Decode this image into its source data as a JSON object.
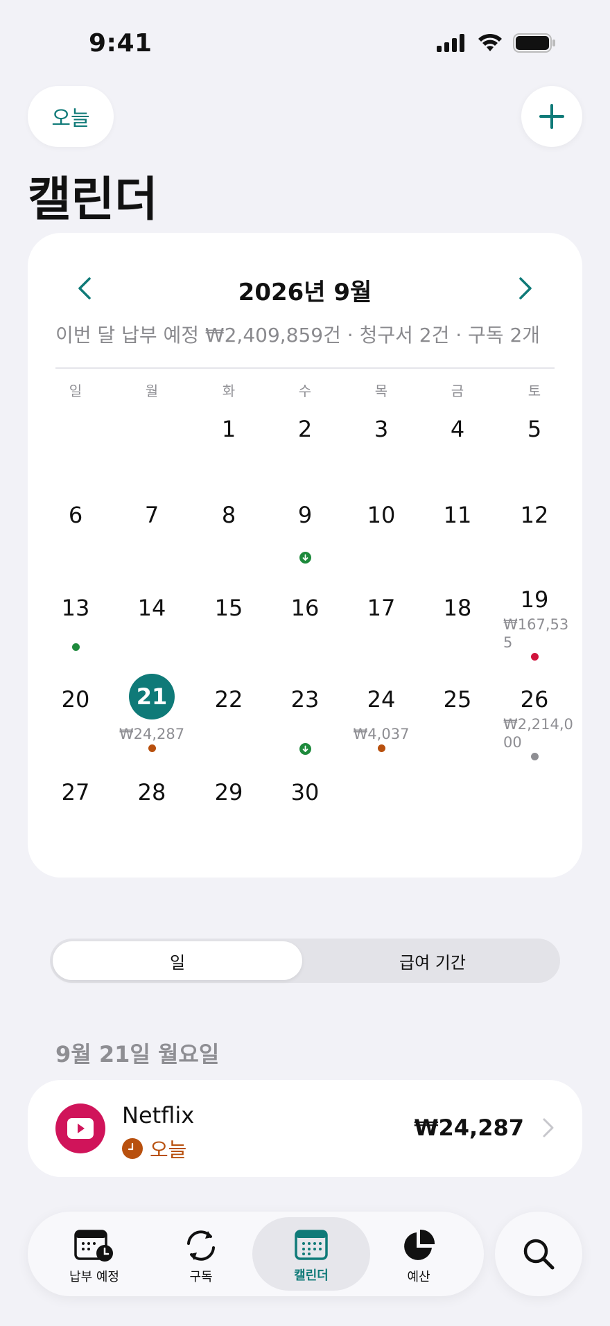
{
  "status_bar": {
    "time": "9:41"
  },
  "header": {
    "today_label": "오늘",
    "title": "캘린더"
  },
  "calendar": {
    "month_title": "2026년 9월",
    "summary": "이번 달 납부 예정 ₩2,409,859건 · 청구서 2건 · 구독 2개",
    "weekdays": [
      "일",
      "월",
      "화",
      "수",
      "목",
      "금",
      "토"
    ],
    "days": {
      "d1": "1",
      "d2": "2",
      "d3": "3",
      "d4": "4",
      "d5": "5",
      "d6": "6",
      "d7": "7",
      "d8": "8",
      "d9": "9",
      "d10": "10",
      "d11": "11",
      "d12": "12",
      "d13": "13",
      "d14": "14",
      "d15": "15",
      "d16": "16",
      "d17": "17",
      "d18": "18",
      "d19": "19",
      "d20": "20",
      "d21": "21",
      "d22": "22",
      "d23": "23",
      "d24": "24",
      "d25": "25",
      "d26": "26",
      "d27": "27",
      "d28": "28",
      "d29": "29",
      "d30": "30"
    },
    "amounts": {
      "d19_line1": "₩167,53",
      "d19_line2": "5",
      "d21": "₩24,287",
      "d24": "₩4,037",
      "d26_line1": "₩2,214,0",
      "d26_line2": "00"
    },
    "colors": {
      "accent": "#0f7a78",
      "income": "#1e8a3c",
      "subscription": "#b8500e",
      "bill": "#d0143c",
      "pending": "#8e8e93"
    }
  },
  "segment": {
    "options": [
      "일",
      "급여 기간"
    ],
    "selected": "일"
  },
  "day_detail": {
    "heading": "9월 21일 월요일",
    "items": [
      {
        "name": "Netflix",
        "status": "오늘",
        "amount": "₩24,287",
        "icon": "play-icon"
      }
    ]
  },
  "tabbar": {
    "tabs": [
      {
        "label": "납부 예정",
        "icon": "calendar-clock-icon"
      },
      {
        "label": "구독",
        "icon": "refresh-icon"
      },
      {
        "label": "캘린더",
        "icon": "calendar-grid-icon"
      },
      {
        "label": "예산",
        "icon": "pie-chart-icon"
      }
    ],
    "active": "캘린더"
  }
}
